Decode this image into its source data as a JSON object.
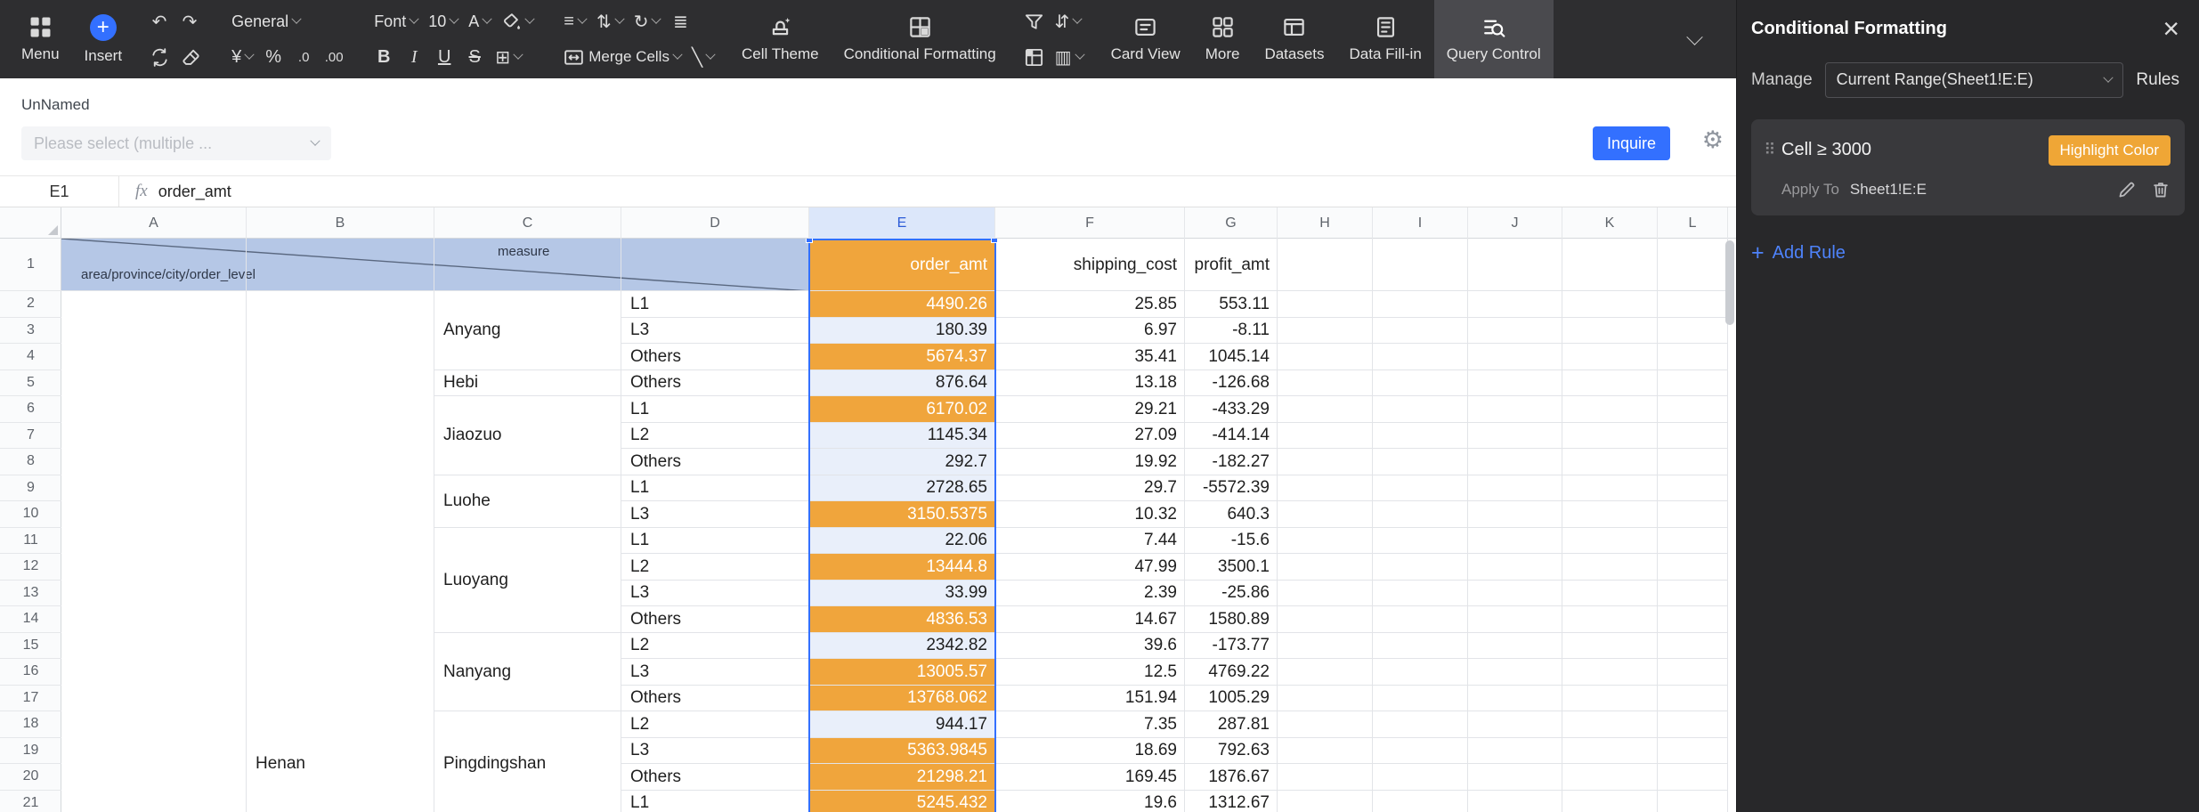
{
  "colors": {
    "highlight_orange": "#F0A53C",
    "accent_blue": "#3370FF",
    "header_fill_blue": "#B5C7E6"
  },
  "icons": {
    "undo": "↶",
    "redo": "↷",
    "currency": "¥",
    "percent": "%",
    "decimal_decrease": ".0",
    "decimal_increase": ".00",
    "borders": "⊞",
    "align_horizontal": "≡",
    "align_vertical": "⇅",
    "text_orientation": "↻",
    "indent": "≣",
    "diagonal": "╲",
    "sort": "⇵",
    "slicer": "▥",
    "gear": "⚙",
    "close": "×",
    "drag_handle": "⠿",
    "plus": "+"
  },
  "toolbar": {
    "menu_label": "Menu",
    "insert_label": "Insert",
    "number_format_value": "General",
    "font_name_value": "Font",
    "font_size_value": "10",
    "font_color_label": "A",
    "bold_label": "B",
    "italic_label": "I",
    "underline_label": "U",
    "strikethrough_label": "S",
    "merge_cells_label": "Merge Cells",
    "cell_theme_label": "Cell Theme",
    "conditional_formatting_label": "Conditional Formatting",
    "card_view_label": "Card View",
    "more_label": "More",
    "datasets_label": "Datasets",
    "data_fillin_label": "Data Fill-in",
    "query_control_label": "Query Control"
  },
  "query_bar": {
    "title": "UnNamed",
    "select_placeholder": "Please select (multiple ...",
    "inquire_label": "Inquire"
  },
  "formula_bar": {
    "cell_ref": "E1",
    "fx_label": "fx",
    "formula": "order_amt"
  },
  "panel": {
    "title": "Conditional Formatting",
    "manage_label": "Manage",
    "manage_value": "Current Range(Sheet1!E:E)",
    "rules_label": "Rules",
    "rule": {
      "condition": "Cell ≥ 3000",
      "style_badge": "Highlight Color",
      "apply_to_label": "Apply To",
      "apply_to_range": "Sheet1!E:E"
    },
    "add_rule_label": "Add Rule"
  },
  "sheet": {
    "column_letters": [
      "A",
      "B",
      "C",
      "D",
      "E",
      "F",
      "G",
      "H",
      "I",
      "J",
      "K",
      "L"
    ],
    "selected_column": "E",
    "visible_rows": 21,
    "diagonal_header": {
      "top_label": "measure",
      "bottom_label": "area/province/city/order_level"
    },
    "measure_headers": [
      {
        "col": "E",
        "label": "order_amt",
        "highlighted": true
      },
      {
        "col": "F",
        "label": "shipping_cost",
        "highlighted": false
      },
      {
        "col": "G",
        "label": "profit_amt",
        "highlighted": false
      }
    ],
    "province_label": "Henan",
    "province_span": {
      "from_row": 18,
      "to_row": 21
    },
    "city_groups": [
      {
        "label": "Anyang",
        "from_row": 2,
        "to_row": 4
      },
      {
        "label": "Hebi",
        "from_row": 5,
        "to_row": 5
      },
      {
        "label": "Jiaozuo",
        "from_row": 6,
        "to_row": 8
      },
      {
        "label": "Luohe",
        "from_row": 9,
        "to_row": 10
      },
      {
        "label": "Luoyang",
        "from_row": 11,
        "to_row": 14
      },
      {
        "label": "Nanyang",
        "from_row": 15,
        "to_row": 17
      },
      {
        "label": "Pingdingshan",
        "from_row": 18,
        "to_row": 21
      }
    ],
    "rows": [
      {
        "row": 2,
        "order_level": "L1",
        "order_amt": "4490.26",
        "shipping_cost": "25.85",
        "profit_amt": "553.11",
        "highlighted": true
      },
      {
        "row": 3,
        "order_level": "L3",
        "order_amt": "180.39",
        "shipping_cost": "6.97",
        "profit_amt": "-8.11",
        "highlighted": false
      },
      {
        "row": 4,
        "order_level": "Others",
        "order_amt": "5674.37",
        "shipping_cost": "35.41",
        "profit_amt": "1045.14",
        "highlighted": true
      },
      {
        "row": 5,
        "order_level": "Others",
        "order_amt": "876.64",
        "shipping_cost": "13.18",
        "profit_amt": "-126.68",
        "highlighted": false
      },
      {
        "row": 6,
        "order_level": "L1",
        "order_amt": "6170.02",
        "shipping_cost": "29.21",
        "profit_amt": "-433.29",
        "highlighted": true
      },
      {
        "row": 7,
        "order_level": "L2",
        "order_amt": "1145.34",
        "shipping_cost": "27.09",
        "profit_amt": "-414.14",
        "highlighted": false
      },
      {
        "row": 8,
        "order_level": "Others",
        "order_amt": "292.7",
        "shipping_cost": "19.92",
        "profit_amt": "-182.27",
        "highlighted": false
      },
      {
        "row": 9,
        "order_level": "L1",
        "order_amt": "2728.65",
        "shipping_cost": "29.7",
        "profit_amt": "-5572.39",
        "highlighted": false
      },
      {
        "row": 10,
        "order_level": "L3",
        "order_amt": "3150.5375",
        "shipping_cost": "10.32",
        "profit_amt": "640.3",
        "highlighted": true
      },
      {
        "row": 11,
        "order_level": "L1",
        "order_amt": "22.06",
        "shipping_cost": "7.44",
        "profit_amt": "-15.6",
        "highlighted": false
      },
      {
        "row": 12,
        "order_level": "L2",
        "order_amt": "13444.8",
        "shipping_cost": "47.99",
        "profit_amt": "3500.1",
        "highlighted": true
      },
      {
        "row": 13,
        "order_level": "L3",
        "order_amt": "33.99",
        "shipping_cost": "2.39",
        "profit_amt": "-25.86",
        "highlighted": false
      },
      {
        "row": 14,
        "order_level": "Others",
        "order_amt": "4836.53",
        "shipping_cost": "14.67",
        "profit_amt": "1580.89",
        "highlighted": true
      },
      {
        "row": 15,
        "order_level": "L2",
        "order_amt": "2342.82",
        "shipping_cost": "39.6",
        "profit_amt": "-173.77",
        "highlighted": false
      },
      {
        "row": 16,
        "order_level": "L3",
        "order_amt": "13005.57",
        "shipping_cost": "12.5",
        "profit_amt": "4769.22",
        "highlighted": true
      },
      {
        "row": 17,
        "order_level": "Others",
        "order_amt": "13768.062",
        "shipping_cost": "151.94",
        "profit_amt": "1005.29",
        "highlighted": true
      },
      {
        "row": 18,
        "order_level": "L2",
        "order_amt": "944.17",
        "shipping_cost": "7.35",
        "profit_amt": "287.81",
        "highlighted": false
      },
      {
        "row": 19,
        "order_level": "L3",
        "order_amt": "5363.9845",
        "shipping_cost": "18.69",
        "profit_amt": "792.63",
        "highlighted": true
      },
      {
        "row": 20,
        "order_level": "Others",
        "order_amt": "21298.21",
        "shipping_cost": "169.45",
        "profit_amt": "1876.67",
        "highlighted": true
      },
      {
        "row": 21,
        "order_level": "L1",
        "order_amt": "5245.432",
        "shipping_cost": "19.6",
        "profit_amt": "1312.67",
        "highlighted": true
      }
    ]
  }
}
